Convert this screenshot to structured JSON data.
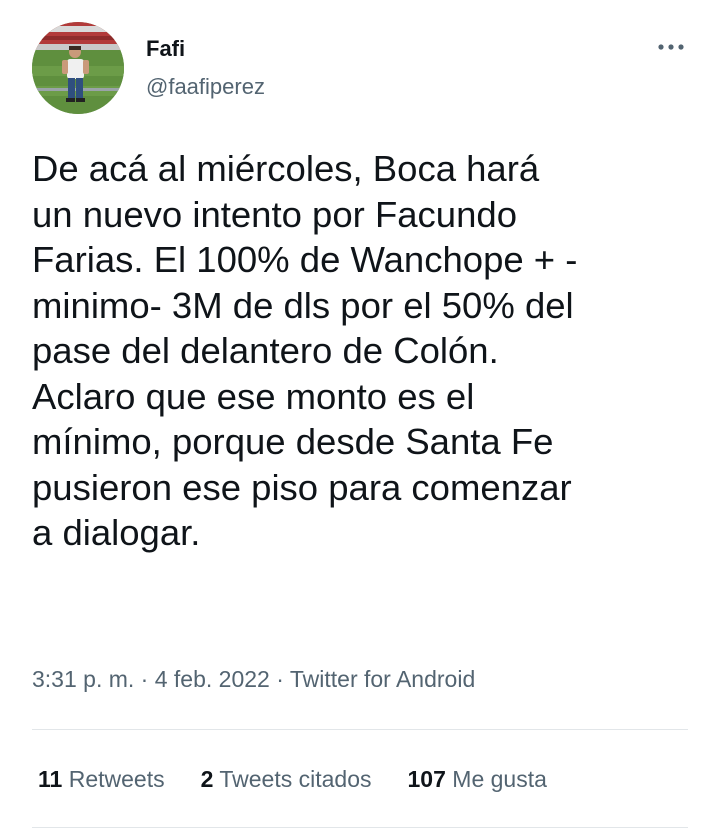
{
  "author": {
    "display_name": "Fafi",
    "handle": "@faafiperez",
    "avatar_icon": "profile-photo-stadium"
  },
  "menu_icon": "more-options-icon",
  "tweet": {
    "text": "De acá al miércoles, Boca hará\nun nuevo intento por Facundo\nFarias. El 100% de Wanchope + -\nminimo- 3M de dls por el 50% del\npase del delantero de Colón.\nAclaro que ese monto es el\nmínimo, porque desde Santa Fe\npusieron ese piso para comenzar\na dialogar."
  },
  "meta": {
    "time": "3:31 p. m.",
    "separator": " · ",
    "date": "4 feb. 2022",
    "source": "Twitter for Android"
  },
  "stats": {
    "retweets_count": "11",
    "retweets_label": "Retweets",
    "quotes_count": "2",
    "quotes_label": "Tweets citados",
    "likes_count": "107",
    "likes_label": "Me gusta"
  },
  "colors": {
    "text_primary": "#0f1419",
    "text_secondary": "#536471",
    "divider": "#e2e6e9"
  }
}
